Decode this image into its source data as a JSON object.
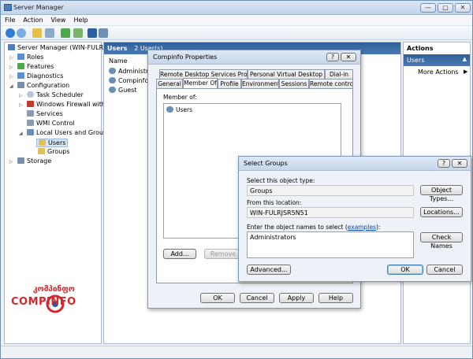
{
  "window": {
    "title": "Server Manager",
    "min_glyph": "—",
    "max_glyph": "▢",
    "close_glyph": "✕"
  },
  "menu": {
    "items": [
      "File",
      "Action",
      "View",
      "Help"
    ]
  },
  "tree": {
    "root": "Server Manager (WIN-FULRJSR5",
    "roles": "Roles",
    "features": "Features",
    "diagnostics": "Diagnostics",
    "configuration": "Configuration",
    "task_scheduler": "Task Scheduler",
    "firewall": "Windows Firewall with A",
    "services": "Services",
    "wmi": "WMI Control",
    "local_users": "Local Users and Groups",
    "users": "Users",
    "groups": "Groups",
    "storage": "Storage"
  },
  "center": {
    "header_title": "Users",
    "header_count": "2 User(s)",
    "column_name": "Name",
    "rows": [
      "Administrat",
      "Compinfo",
      "Guest"
    ]
  },
  "actions": {
    "title": "Actions",
    "section": "Users",
    "more": "More Actions"
  },
  "logo": {
    "brand": "COMPINFO",
    "tagline": "კომპინფო"
  },
  "props_dialog": {
    "title": "Compinfo Properties",
    "help_glyph": "?",
    "close_glyph": "✕",
    "tabs_row1": [
      "Remote Desktop Services Profile",
      "Personal Virtual Desktop",
      "Dial-in"
    ],
    "tabs_row2": [
      "General",
      "Member Of",
      "Profile",
      "Environment",
      "Sessions",
      "Remote control"
    ],
    "member_of_label": "Member of:",
    "member_item": "Users",
    "add_button": "Add...",
    "remove_button": "Remove",
    "ok": "OK",
    "cancel": "Cancel",
    "apply": "Apply",
    "help": "Help"
  },
  "select_dialog": {
    "title": "Select Groups",
    "help_glyph": "?",
    "close_glyph": "✕",
    "object_type_label": "Select this object type:",
    "object_type_value": "Groups",
    "object_types_button": "Object Types...",
    "location_label": "From this location:",
    "location_value": "WIN-FULRJSR5N51",
    "locations_button": "Locations...",
    "names_label_prefix": "Enter the object names to select (",
    "names_label_link": "examples",
    "names_label_suffix": "):",
    "names_value": "Administrators",
    "check_names_button": "Check Names",
    "advanced_button": "Advanced...",
    "ok": "OK",
    "cancel": "Cancel"
  },
  "colors": {
    "accent": "#2f5f98",
    "logo_red": "#d6262d",
    "logo_blue": "#1e5aa8"
  }
}
